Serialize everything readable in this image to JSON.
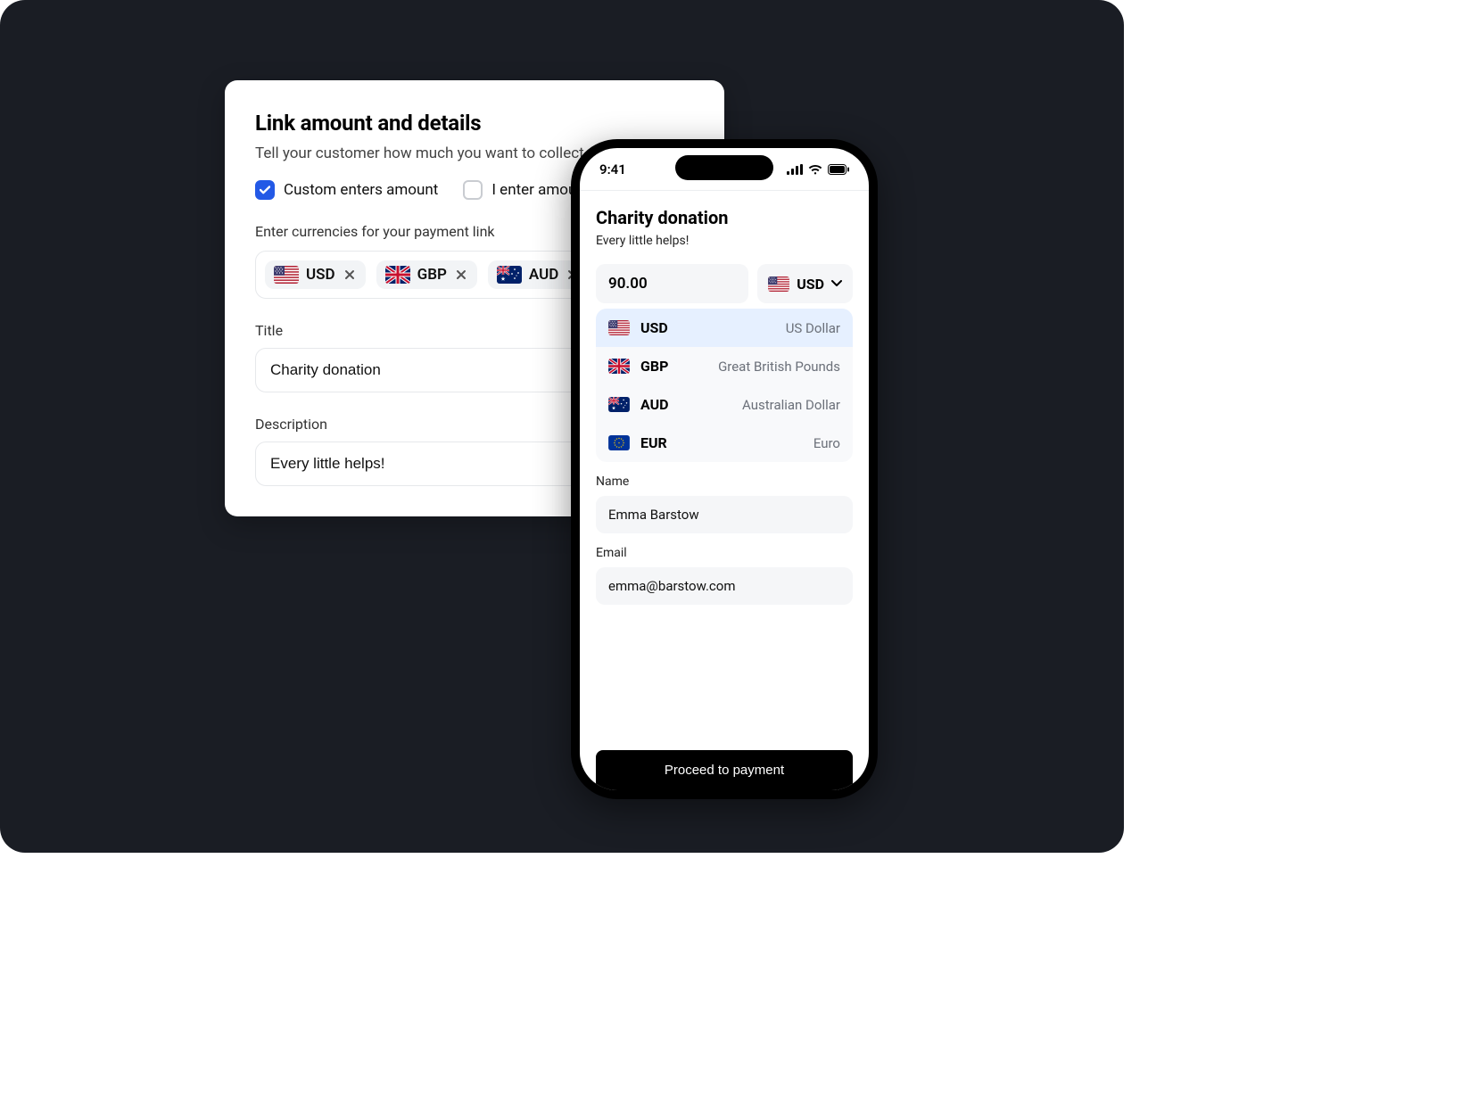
{
  "panel": {
    "heading": "Link amount and details",
    "subtitle": "Tell your customer how much you want to collect",
    "option_custom": "Custom enters amount",
    "option_fixed": "I enter amount",
    "currencies_label": "Enter currencies for your payment link",
    "chips": [
      {
        "code": "USD",
        "flag": "us"
      },
      {
        "code": "GBP",
        "flag": "gb"
      },
      {
        "code": "AUD",
        "flag": "au"
      }
    ],
    "title_label": "Title",
    "title_value": "Charity donation",
    "description_label": "Description",
    "description_value": "Every little helps!"
  },
  "phone": {
    "time": "9:41",
    "heading": "Charity donation",
    "tagline": "Every little helps!",
    "amount": "90.00",
    "currency_selected": "USD",
    "currency_flag": "us",
    "options": [
      {
        "code": "USD",
        "name": "US Dollar",
        "flag": "us",
        "selected": true
      },
      {
        "code": "GBP",
        "name": "Great British Pounds",
        "flag": "gb",
        "selected": false
      },
      {
        "code": "AUD",
        "name": "Australian Dollar",
        "flag": "au",
        "selected": false
      },
      {
        "code": "EUR",
        "name": "Euro",
        "flag": "eu",
        "selected": false
      }
    ],
    "name_label": "Name",
    "name_value": "Emma Barstow",
    "email_label": "Email",
    "email_value": "emma@barstow.com",
    "proceed": "Proceed to payment"
  }
}
